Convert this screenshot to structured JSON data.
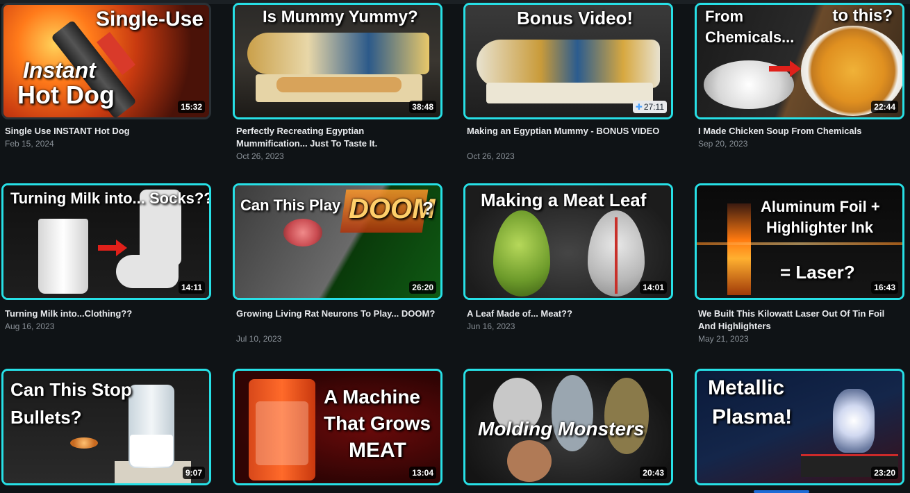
{
  "videos": [
    {
      "thumb_text": [
        "Single-Use",
        "Instant",
        "Hot Dog"
      ],
      "duration": "15:32",
      "title": "Single Use INSTANT Hot Dog",
      "date": "Feb 15, 2024"
    },
    {
      "thumb_text": [
        "Is Mummy Yummy?"
      ],
      "duration": "38:48",
      "title": "Perfectly Recreating Egyptian Mummification... Just To Taste It.",
      "date": "Oct 26, 2023"
    },
    {
      "thumb_text": [
        "Bonus Video!"
      ],
      "duration": "27:11",
      "title": "Making an Egyptian Mummy - BONUS VIDEO",
      "date": "Oct 26, 2023"
    },
    {
      "thumb_text": [
        "From",
        "Chemicals...",
        "to this?"
      ],
      "duration": "22:44",
      "title": "I Made Chicken Soup From Chemicals",
      "date": "Sep 20, 2023"
    },
    {
      "thumb_text": [
        "Turning Milk into... Socks??"
      ],
      "duration": "14:11",
      "title": "Turning Milk into...Clothing??",
      "date": "Aug 16, 2023"
    },
    {
      "thumb_text": [
        "Can This Play",
        "DOOM",
        "?"
      ],
      "duration": "26:20",
      "title": "Growing Living Rat Neurons To Play... DOOM?",
      "date": "Jul 10, 2023"
    },
    {
      "thumb_text": [
        "Making a Meat Leaf"
      ],
      "duration": "14:01",
      "title": "A Leaf Made of... Meat??",
      "date": "Jun 16, 2023"
    },
    {
      "thumb_text": [
        "Aluminum Foil +",
        "Highlighter Ink",
        "= Laser?"
      ],
      "duration": "16:43",
      "title": "We Built This Kilowatt Laser Out Of Tin Foil And Highlighters",
      "date": "May 21, 2023"
    },
    {
      "thumb_text": [
        "Can This Stop",
        "Bullets?"
      ],
      "duration": "9:07",
      "title": "",
      "date": ""
    },
    {
      "thumb_text": [
        "A Machine",
        "That Grows",
        "MEAT"
      ],
      "duration": "13:04",
      "title": "",
      "date": ""
    },
    {
      "thumb_text": [
        "Molding Monsters"
      ],
      "duration": "20:43",
      "title": "",
      "date": ""
    },
    {
      "thumb_text": [
        "Metallic",
        "Plasma!"
      ],
      "duration": "23:20",
      "title": "",
      "date": ""
    }
  ],
  "colors": {
    "background": "#0f1316",
    "thumb_border": "#27e0e6",
    "title": "#e8eaed",
    "date": "#8a9198"
  },
  "icons": {
    "members_badge": "plus-icon"
  }
}
